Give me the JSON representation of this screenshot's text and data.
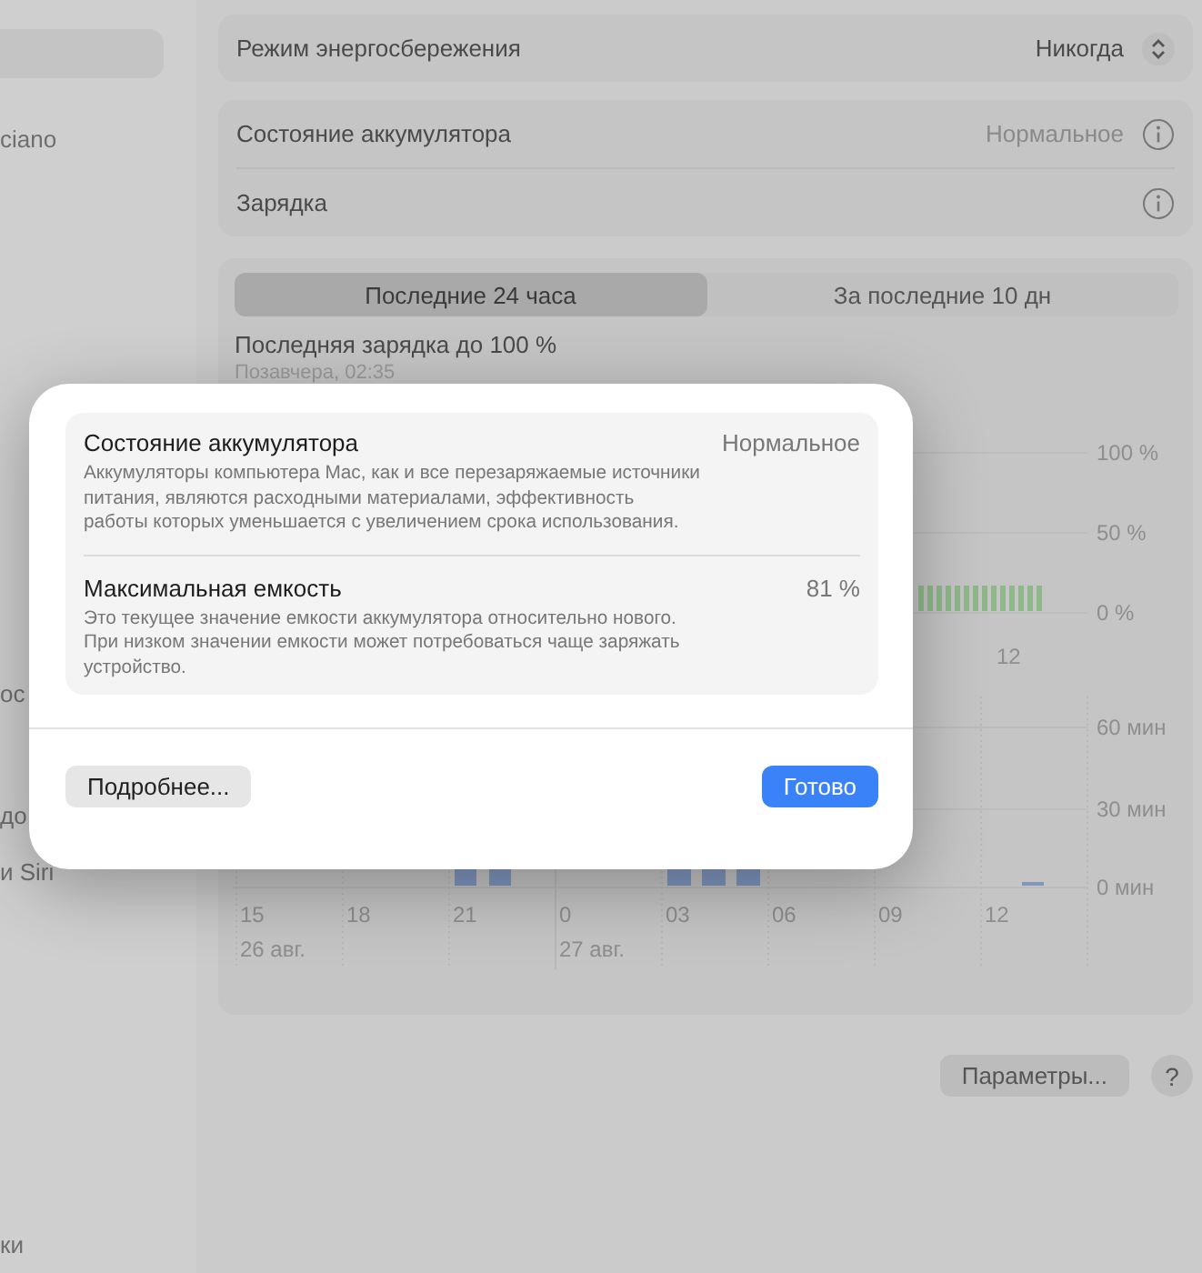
{
  "sidebar": {
    "items": [
      {
        "label": "ciano"
      },
      {
        "label": "ос"
      },
      {
        "label": "до"
      },
      {
        "label": "и Siri"
      },
      {
        "label": "ки"
      }
    ]
  },
  "power_mode": {
    "label": "Режим энергосбережения",
    "value": "Никогда"
  },
  "battery": {
    "rows": [
      {
        "label": "Состояние аккумулятора",
        "value": "Нормальное"
      },
      {
        "label": "Зарядка"
      }
    ]
  },
  "history": {
    "tabs": [
      {
        "label": "Последние 24 часа",
        "selected": true
      },
      {
        "label": "За последние 10 дн",
        "selected": false
      }
    ],
    "last_charge": "Последняя зарядка до 100 %",
    "last_charge_time": "Позавчера, 02:35",
    "level_chart": {
      "y_labels": [
        "100 %",
        "50 %",
        "0 %"
      ],
      "x_labels": [
        "12"
      ]
    },
    "usage_chart": {
      "y_labels": [
        "60 мин",
        "30 мин",
        "0 мин"
      ],
      "x_labels": [
        "15",
        "18",
        "21",
        "0",
        "03",
        "06",
        "09",
        "12"
      ],
      "dates": [
        "26 авг.",
        "27 авг."
      ]
    }
  },
  "buttons": {
    "options": "Параметры...",
    "help": "?"
  },
  "dialog": {
    "items": [
      {
        "title": "Состояние аккумулятора",
        "value": "Нормальное",
        "description": "Аккумуляторы компьютера Mac, как и все перезаряжаемые источники питания, являются расходными материалами, эффективность работы которых уменьшается с увеличением срока использования."
      },
      {
        "title": "Максимальная емкость",
        "value": "81 %",
        "description": "Это текущее значение емкости аккумулятора относительно нового. При низком значении емкости может потребоваться чаще заряжать устройство."
      }
    ],
    "more_button": "Подробнее...",
    "done_button": "Готово"
  }
}
